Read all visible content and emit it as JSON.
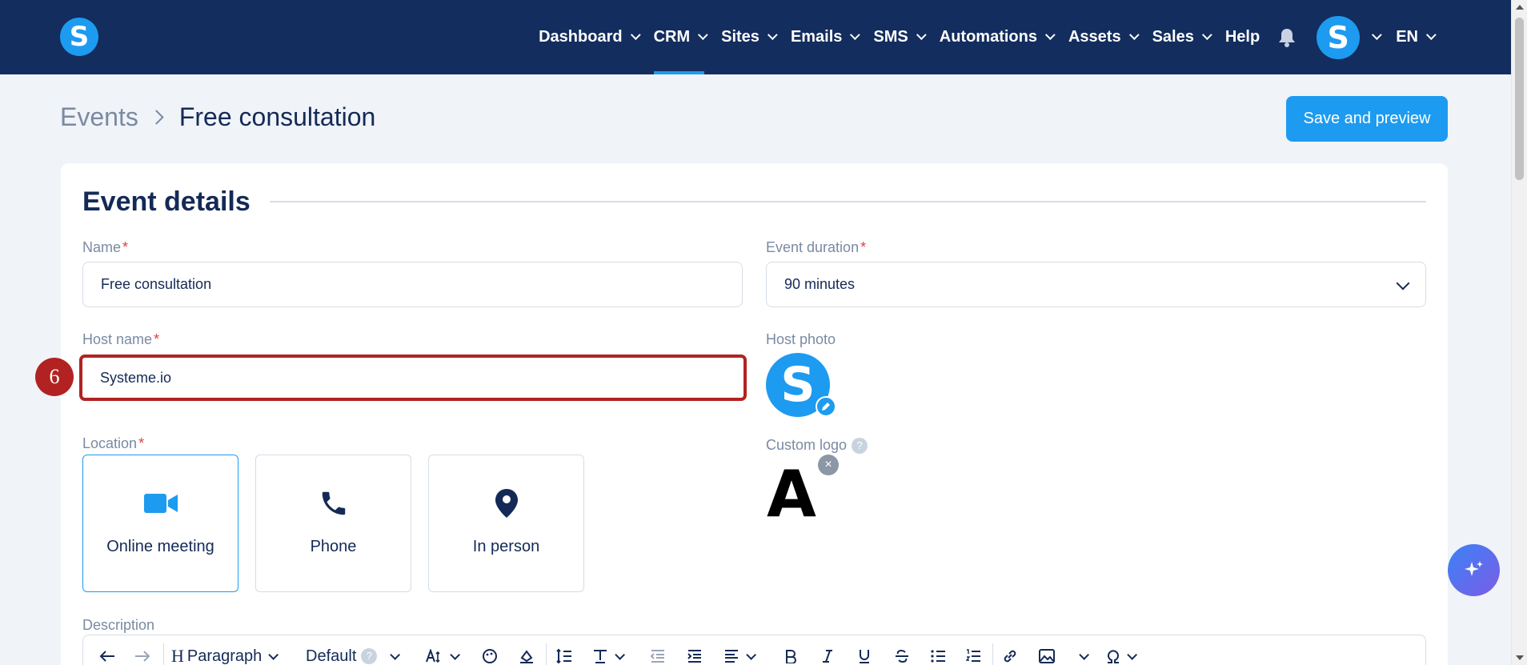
{
  "nav": {
    "logo_letter": "S",
    "items": [
      {
        "label": "Dashboard",
        "has_menu": true
      },
      {
        "label": "CRM",
        "has_menu": true,
        "active": true
      },
      {
        "label": "Sites",
        "has_menu": true
      },
      {
        "label": "Emails",
        "has_menu": true
      },
      {
        "label": "SMS",
        "has_menu": true
      },
      {
        "label": "Automations",
        "has_menu": true
      },
      {
        "label": "Assets",
        "has_menu": true
      },
      {
        "label": "Sales",
        "has_menu": true
      },
      {
        "label": "Help",
        "has_menu": false
      }
    ],
    "avatar_letter": "S",
    "language": "EN",
    "bg_color": "#132d5e",
    "accent_color": "#1d9bf0"
  },
  "breadcrumb": {
    "parent": "Events",
    "current": "Free consultation"
  },
  "actions": {
    "save_label": "Save and preview"
  },
  "card": {
    "title": "Event details",
    "name": {
      "label": "Name",
      "value": "Free consultation"
    },
    "duration": {
      "label": "Event duration",
      "value": "90 minutes"
    },
    "host_name": {
      "label": "Host name",
      "value": "Systeme.io"
    },
    "host_photo": {
      "label": "Host photo",
      "letter": "S"
    },
    "custom_logo": {
      "label": "Custom logo",
      "help": "?",
      "logo_letter": "A",
      "remove": "×"
    },
    "location": {
      "label": "Location",
      "options": [
        {
          "label": "Online meeting",
          "icon": "video-camera-icon",
          "selected": true
        },
        {
          "label": "Phone",
          "icon": "phone-icon",
          "selected": false
        },
        {
          "label": "In person",
          "icon": "map-pin-icon",
          "selected": false
        }
      ]
    },
    "description": {
      "label": "Description",
      "toolbar": {
        "heading_letter": "H",
        "paragraph": "Paragraph",
        "font": "Default",
        "font_help": "?"
      }
    }
  },
  "annotation": {
    "step_number": "6",
    "color": "#b22222"
  },
  "required_marker": "*"
}
